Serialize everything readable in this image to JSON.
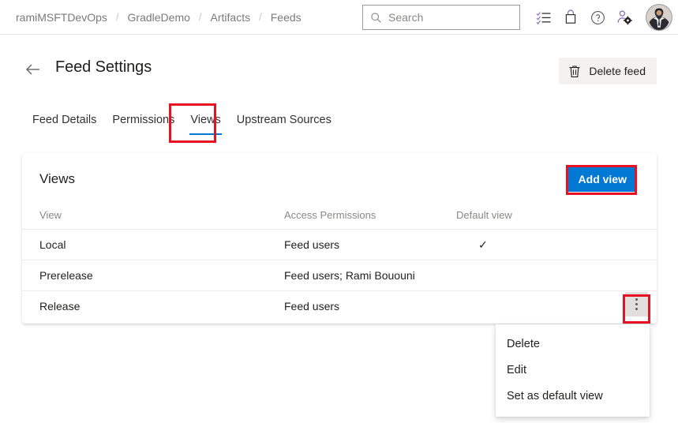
{
  "topbar": {
    "breadcrumb": [
      {
        "label": "ramiMSFTDevOps"
      },
      {
        "label": "GradleDemo"
      },
      {
        "label": "Artifacts"
      },
      {
        "label": "Feeds"
      }
    ],
    "separator": "/",
    "search": {
      "placeholder": "Search",
      "value": "",
      "icon": "search-icon"
    },
    "icons": [
      {
        "name": "tasks-checklist-icon"
      },
      {
        "name": "shopping-bag-icon"
      },
      {
        "name": "help-circle-icon"
      },
      {
        "name": "user-settings-icon"
      }
    ],
    "avatar": {
      "name": "user-avatar"
    }
  },
  "header": {
    "back_icon": "back-arrow-icon",
    "title": "Feed Settings",
    "delete_feed_label": "Delete feed",
    "delete_icon": "trash-icon"
  },
  "tabs": [
    {
      "label": "Feed Details",
      "active": false
    },
    {
      "label": "Permissions",
      "active": false
    },
    {
      "label": "Views",
      "active": true
    },
    {
      "label": "Upstream Sources",
      "active": false
    }
  ],
  "card": {
    "title": "Views",
    "add_view_label": "Add view"
  },
  "table": {
    "columns": [
      "View",
      "Access Permissions",
      "Default view"
    ],
    "rows": [
      {
        "view": "Local",
        "permissions": "Feed users",
        "default": "✓",
        "menu_open": false
      },
      {
        "view": "Prerelease",
        "permissions": "Feed users; Rami Bououni",
        "default": "",
        "menu_open": false
      },
      {
        "view": "Release",
        "permissions": "Feed users",
        "default": "",
        "menu_open": true
      }
    ]
  },
  "context_menu": {
    "items": [
      {
        "label": "Delete"
      },
      {
        "label": "Edit"
      },
      {
        "label": "Set as default view"
      }
    ]
  },
  "colors": {
    "accent_blue": "#0078d4",
    "annotation_red": "#e81123",
    "button_gray": "#f3f2f1",
    "text_primary": "#201f1e",
    "text_secondary": "#8a8886"
  }
}
